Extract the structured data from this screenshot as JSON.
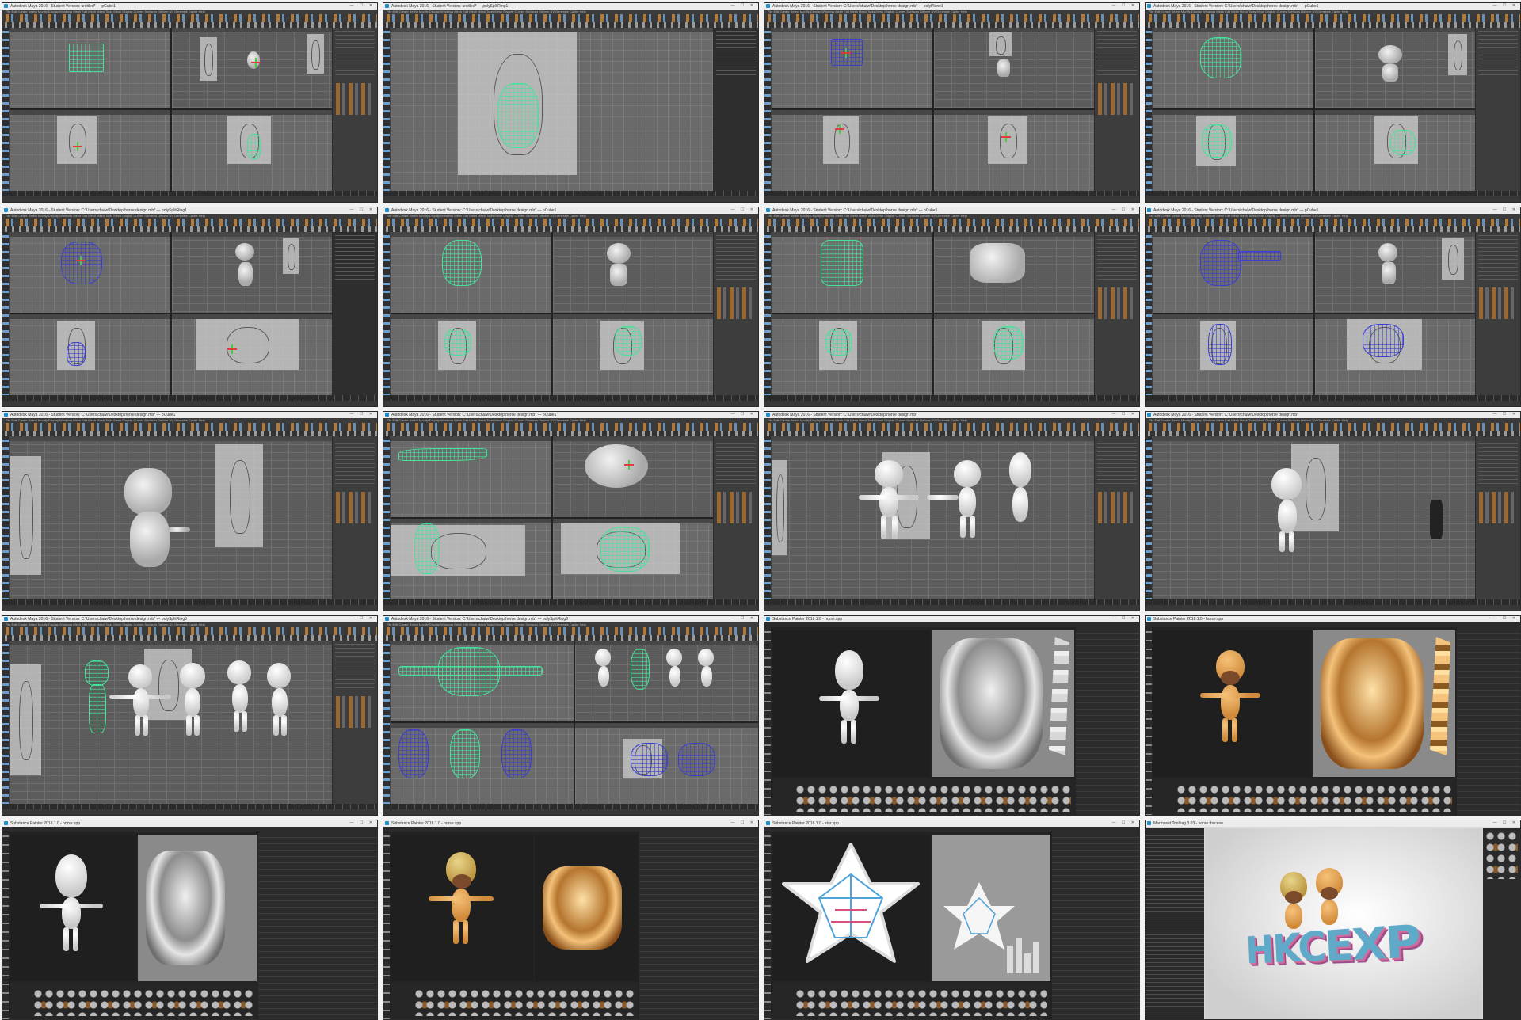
{
  "windows": [
    {
      "title": "Autodesk Maya 2016 - Student Version: untitled* --- pCube1"
    },
    {
      "title": "Autodesk Maya 2016 - Student Version: untitled* --- polySplitRing1"
    },
    {
      "title": "Autodesk Maya 2016 - Student Version: C:\\Users\\chuiw\\Desktop\\horse design.mb* --- polyPlane1"
    },
    {
      "title": "Autodesk Maya 2016 - Student Version: C:\\Users\\chuiw\\Desktop\\horse design.mb* --- pCube1"
    },
    {
      "title": "Autodesk Maya 2016 - Student Version: C:\\Users\\chuiw\\Desktop\\horse design.mb* --- polySplitRing1"
    },
    {
      "title": "Autodesk Maya 2016 - Student Version: C:\\Users\\chuiw\\Desktop\\horse design.mb* --- pCube1"
    },
    {
      "title": "Autodesk Maya 2016 - Student Version: C:\\Users\\chuiw\\Desktop\\horse design.mb* --- pCube1"
    },
    {
      "title": "Autodesk Maya 2016 - Student Version: C:\\Users\\chuiw\\Desktop\\horse design.mb* --- pCube1"
    },
    {
      "title": "Autodesk Maya 2016 - Student Version: C:\\Users\\chuiw\\Desktop\\horse design.mb* --- pCube1"
    },
    {
      "title": "Autodesk Maya 2016 - Student Version: C:\\Users\\chuiw\\Desktop\\horse design.mb* --- pCube1"
    },
    {
      "title": "Autodesk Maya 2016 - Student Version: C:\\Users\\chuiw\\Desktop\\horse design.mb*"
    },
    {
      "title": "Autodesk Maya 2016 - Student Version: C:\\Users\\chuiw\\Desktop\\horse design.mb*"
    },
    {
      "title": "Autodesk Maya 2016 - Student Version: C:\\Users\\chuiw\\Desktop\\horse design.mb* --- polySplitRing3"
    },
    {
      "title": "Autodesk Maya 2016 - Student Version: C:\\Users\\chuiw\\Desktop\\horse design.mb* --- polySplitRing3"
    },
    {
      "title": "Substance Painter 2018.1.0 - horse.spp"
    },
    {
      "title": "Substance Painter 2018.1.0 - horse.spp"
    },
    {
      "title": "Substance Painter 2018.1.0 - horse.spp"
    },
    {
      "title": "Substance Painter 2018.1.0 - horse.spp"
    },
    {
      "title": "Substance Painter 2018.1.0 - star.spp"
    },
    {
      "title": "Marmoset Toolbag 3.03 - horse.tbscene"
    }
  ],
  "maya_menu": "File  Edit  Create  Select  Modify  Display  Windows  Mesh  Edit Mesh  Mesh Tools  Mesh Display  Curves  Surfaces  Deform  UV  Generate  Cache  Help",
  "window_buttons": "— ☐ ✕",
  "final_text": "HKCEXP",
  "colors": {
    "maya_bg": "#444444",
    "substance_bg": "#232323",
    "mesh_green": "#44e39a",
    "mesh_blue": "#3b3fcf",
    "horse_orange": "#e4a150"
  }
}
